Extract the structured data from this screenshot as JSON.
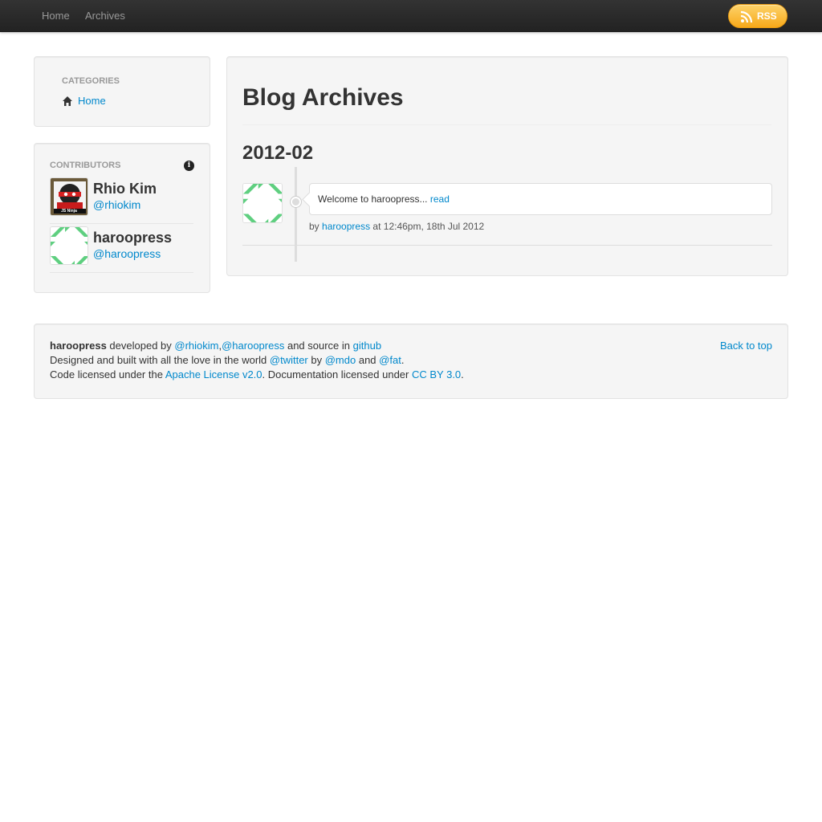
{
  "navbar": {
    "links": [
      "Home",
      "Archives"
    ],
    "rss_label": "RSS",
    "rss_color": "#f9b52c"
  },
  "sidebar": {
    "categories": {
      "header": "CATEGORIES",
      "items": [
        {
          "label": "Home",
          "icon": "home-icon"
        }
      ]
    },
    "contributors": {
      "header": "CONTRIBUTORS",
      "info_icon": "info-icon",
      "people": [
        {
          "name": "Rhio Kim",
          "handle": "@rhiokim",
          "avatar_badge": "JS Ninja"
        },
        {
          "name": "haroopress",
          "handle": "@haroopress"
        }
      ]
    }
  },
  "main": {
    "title": "Blog Archives",
    "year": "2012-02",
    "posts": [
      {
        "summary": "Welcome to haroopress...",
        "read_label": "read",
        "by_label": "by",
        "author": "haroopress",
        "time": "at 12:46pm, 18th Jul 2012"
      }
    ]
  },
  "footer": {
    "line1": {
      "brand": "haroopress",
      "developed_by": " developed by ",
      "dev1": "@rhiokim",
      "comma": ",",
      "dev2": "@haroopress",
      "source_text": " and source in ",
      "source_link": "github"
    },
    "line2": {
      "text1": "Designed and built with all the love in the world ",
      "twitter": "@twitter",
      "by": " by ",
      "mdo": "@mdo",
      "and": " and ",
      "fat": "@fat",
      "end": "."
    },
    "line3": {
      "text1": "Code licensed under the ",
      "license1": "Apache License v2.0",
      "text2": ". Documentation licensed under ",
      "license2": "CC BY 3.0",
      "end": "."
    },
    "back_to_top": "Back to top"
  },
  "colors": {
    "link": "#0088cc",
    "navbar": "#2b2b2b",
    "well": "#f5f5f5",
    "identicon": "#5fcf80"
  }
}
